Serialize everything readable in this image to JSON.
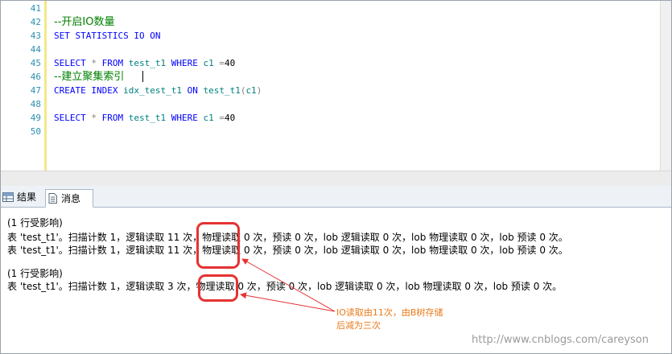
{
  "editor": {
    "lines": [
      {
        "no": "41",
        "segments": []
      },
      {
        "no": "42",
        "segments": [
          {
            "cls": "cmt",
            "text": "--开启IO数量"
          }
        ]
      },
      {
        "no": "43",
        "segments": [
          {
            "cls": "kw",
            "text": "SET STATISTICS IO ON"
          }
        ]
      },
      {
        "no": "44",
        "segments": []
      },
      {
        "no": "45",
        "segments": [
          {
            "cls": "kw",
            "text": "SELECT "
          },
          {
            "cls": "gray",
            "text": "* "
          },
          {
            "cls": "kw",
            "text": "FROM "
          },
          {
            "cls": "obj",
            "text": "test_t1 "
          },
          {
            "cls": "kw",
            "text": "WHERE "
          },
          {
            "cls": "obj",
            "text": "c1 "
          },
          {
            "cls": "gray",
            "text": "="
          },
          {
            "cls": "",
            "text": "40"
          }
        ]
      },
      {
        "no": "46",
        "segments": [
          {
            "cls": "cmt",
            "text": "--建立聚集索引"
          }
        ]
      },
      {
        "no": "47",
        "segments": [
          {
            "cls": "kw",
            "text": "CREATE INDEX "
          },
          {
            "cls": "obj",
            "text": "idx_test_t1 "
          },
          {
            "cls": "kw",
            "text": "ON "
          },
          {
            "cls": "obj",
            "text": "test_t1"
          },
          {
            "cls": "gray",
            "text": "("
          },
          {
            "cls": "obj",
            "text": "c1"
          },
          {
            "cls": "gray",
            "text": ")"
          }
        ]
      },
      {
        "no": "48",
        "segments": []
      },
      {
        "no": "49",
        "segments": [
          {
            "cls": "kw",
            "text": "SELECT "
          },
          {
            "cls": "gray",
            "text": "* "
          },
          {
            "cls": "kw",
            "text": "FROM "
          },
          {
            "cls": "obj",
            "text": "test_t1 "
          },
          {
            "cls": "kw",
            "text": "WHERE "
          },
          {
            "cls": "obj",
            "text": "c1 "
          },
          {
            "cls": "gray",
            "text": "="
          },
          {
            "cls": "",
            "text": "40"
          }
        ]
      },
      {
        "no": "50",
        "segments": []
      }
    ]
  },
  "tabs": {
    "results": "结果",
    "messages": "消息"
  },
  "messages": {
    "rows_affected_1": "(1 行受影响)",
    "stats_1a": "表 'test_t1'。扫描计数 1，逻辑读取 11 次，物理读取 0 次，预读 0 次，lob 逻辑读取 0 次，lob 物理读取 0 次，lob 预读 0 次。",
    "stats_1b": "表 'test_t1'。扫描计数 1，逻辑读取 11 次，物理读取 0 次，预读 0 次，lob 逻辑读取 0 次，lob 物理读取 0 次，lob 预读 0 次。",
    "rows_affected_2": "(1 行受影响)",
    "stats_2": "表 'test_t1'。扫描计数 1，逻辑读取 3 次，物理读取 0 次，预读 0 次，lob 逻辑读取 0 次，lob 物理读取 0 次，lob 预读 0 次。"
  },
  "annotation": {
    "line1": "IO读取由11次，由B树存储",
    "line2": "后减为三次"
  },
  "watermark": "http://www.cnblogs.com/careyson",
  "colors": {
    "highlight": "#e53232",
    "annotation": "#e97a18",
    "keyword": "#0000ff",
    "comment": "#008000",
    "line_number": "#2b91af"
  }
}
